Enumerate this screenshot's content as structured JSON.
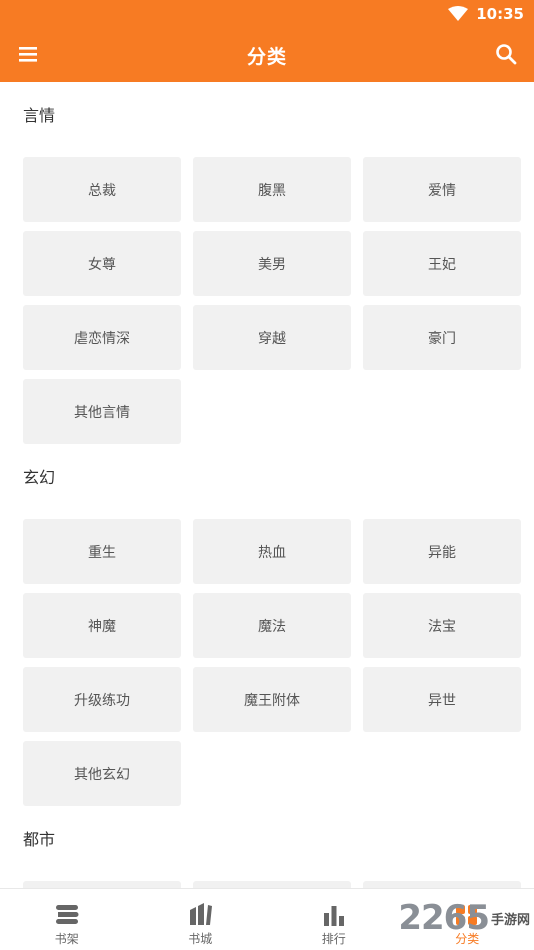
{
  "status": {
    "time": "10:35"
  },
  "header": {
    "title": "分类"
  },
  "sections": [
    {
      "title": "言情",
      "items": [
        "总裁",
        "腹黑",
        "爱情",
        "女尊",
        "美男",
        "王妃",
        "虐恋情深",
        "穿越",
        "豪门",
        "其他言情"
      ]
    },
    {
      "title": "玄幻",
      "items": [
        "重生",
        "热血",
        "异能",
        "神魔",
        "魔法",
        "法宝",
        "升级练功",
        "魔王附体",
        "异世",
        "其他玄幻"
      ]
    },
    {
      "title": "都市",
      "items": []
    }
  ],
  "tabs": [
    {
      "label": "书架",
      "icon": "bookshelf-icon"
    },
    {
      "label": "书城",
      "icon": "bookstore-icon"
    },
    {
      "label": "排行",
      "icon": "ranking-icon"
    },
    {
      "label": "分类",
      "icon": "category-icon"
    }
  ],
  "watermark": {
    "number": "2265",
    "text": "手游网"
  },
  "colors": {
    "accent": "#f77b23",
    "tile": "#f1f1f1"
  }
}
